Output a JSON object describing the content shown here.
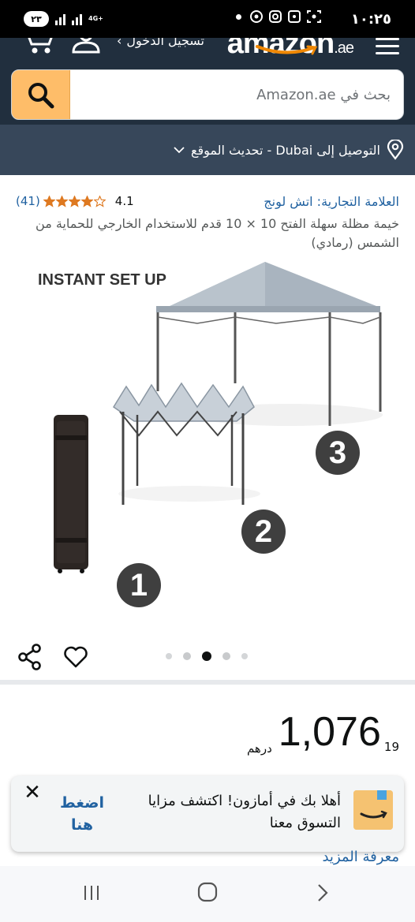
{
  "status_bar": {
    "time": "١٠:٢٥",
    "battery": "٢٣",
    "network": "4G+"
  },
  "header": {
    "logo_text": "amazon",
    "logo_tld": ".ae",
    "signin_label": "تسجيل الدخول",
    "brand_color": "#212f3e",
    "accent_color": "#febd69"
  },
  "search": {
    "placeholder": "بحث في Amazon.ae"
  },
  "location": {
    "text": "التوصيل إلى Dubai - تحديث الموقع"
  },
  "product": {
    "brand_link": "العلامة التجارية: اتش لونج",
    "rating_value": "4.1",
    "rating_stars": 4.1,
    "rating_count": "(41)",
    "title": "خيمة مظلة سهلة الفتح 10 × 10 قدم للاستخدام الخارجي للحماية من الشمس (رمادي)"
  },
  "gallery": {
    "label": "INSTANT SET UP",
    "badges": [
      "1",
      "2",
      "3"
    ],
    "dots_count": 5,
    "active_dot": 3
  },
  "price": {
    "whole": "1,076",
    "fraction": "19",
    "currency": "درهم"
  },
  "welcome_banner": {
    "text": "أهلا بك في أمازون! اكتشف مزايا التسوق معنا",
    "cta": "اضغط هنا",
    "close": "✕"
  },
  "learn_more": "معرفة المزيد",
  "icons": {
    "menu": "hamburger-icon",
    "cart": "cart-icon",
    "user": "user-icon",
    "search": "search-icon",
    "location": "location-pin-icon",
    "share": "share-icon",
    "wishlist": "heart-icon"
  }
}
